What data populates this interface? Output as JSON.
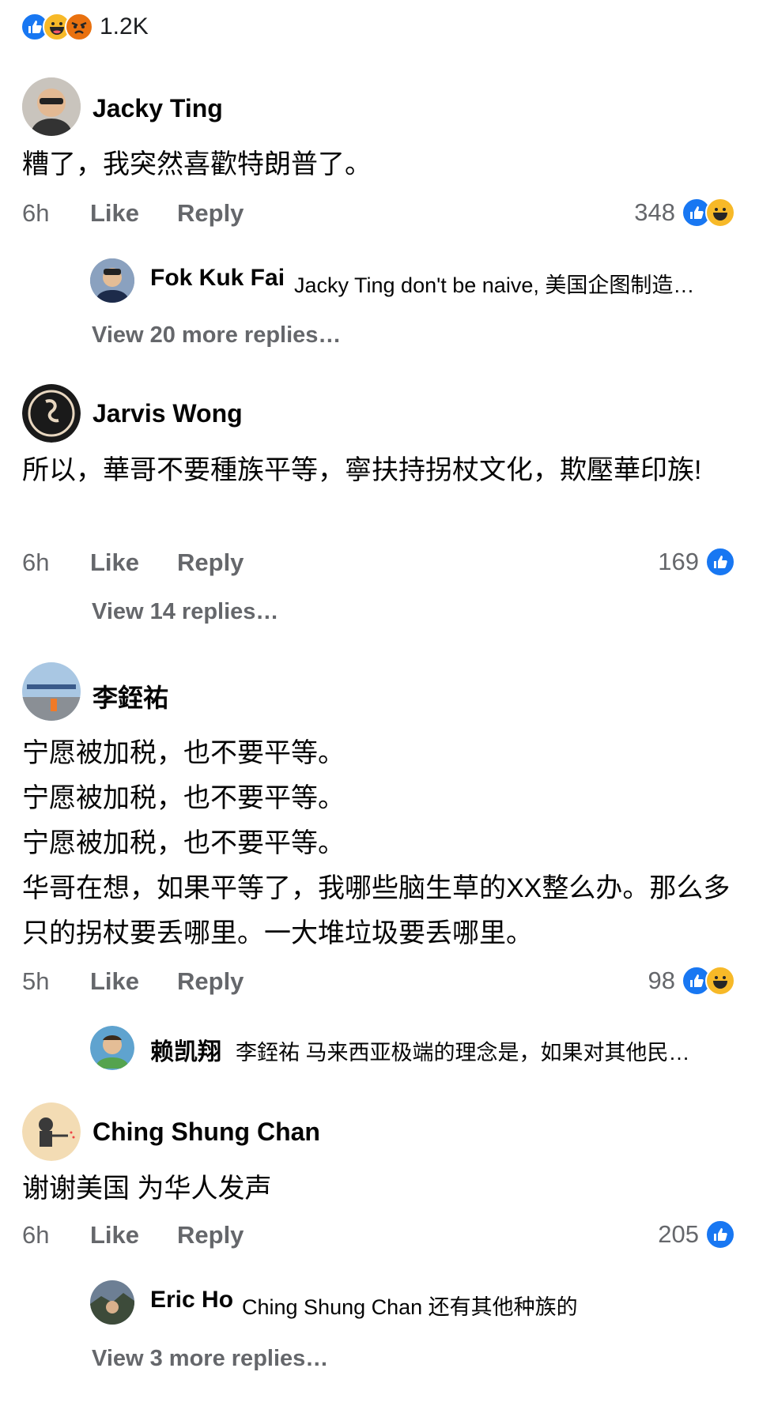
{
  "top_bar": {
    "reaction_total": "1.2K",
    "reaction_icons": [
      "like-icon",
      "haha-icon",
      "angry-icon"
    ]
  },
  "comments": [
    {
      "author": "Jacky Ting",
      "text": "糟了，我突然喜歡特朗普了。",
      "time": "6h",
      "like_label": "Like",
      "reply_label": "Reply",
      "reaction_count": "348",
      "reaction_icons": [
        "like-icon",
        "haha-icon"
      ],
      "reply_preview": {
        "author": "Fok Kuk Fai",
        "text": "Jacky Ting don't be naive, 美国企图制造…"
      },
      "view_more": "View 20 more replies…"
    },
    {
      "author": "Jarvis Wong",
      "text": "所以，華哥不要種族平等，寧扶持拐杖文化，欺壓華印族!",
      "time": "6h",
      "like_label": "Like",
      "reply_label": "Reply",
      "reaction_count": "169",
      "reaction_icons": [
        "like-icon"
      ],
      "view_more": "View 14 replies…"
    },
    {
      "author": "李銍祐",
      "text_lines": [
        "宁愿被加税，也不要平等。",
        "宁愿被加税，也不要平等。",
        "宁愿被加税，也不要平等。",
        "华哥在想，如果平等了，我哪些脑生草的XX整么办。那么多只的拐杖要丢哪里。一大堆垃圾要丢哪里。"
      ],
      "time": "5h",
      "like_label": "Like",
      "reply_label": "Reply",
      "reaction_count": "98",
      "reaction_icons": [
        "like-icon",
        "haha-icon"
      ],
      "reply_preview": {
        "author": "赖凯翔",
        "text": "李銍祐 马来西亚极端的理念是，如果对其他民…"
      }
    },
    {
      "author": "Ching Shung Chan",
      "text": "谢谢美国 为华人发声",
      "time": "6h",
      "like_label": "Like",
      "reply_label": "Reply",
      "reaction_count": "205",
      "reaction_icons": [
        "like-icon"
      ],
      "reply_preview": {
        "author": "Eric Ho",
        "text": "Ching Shung Chan 还有其他种族的"
      },
      "view_more": "View 3 more replies…"
    }
  ],
  "colors": {
    "like_blue": "#1877f2",
    "haha_yellow": "#f7b928",
    "angry_orange": "#e9710f",
    "secondary_text": "#65676b"
  }
}
